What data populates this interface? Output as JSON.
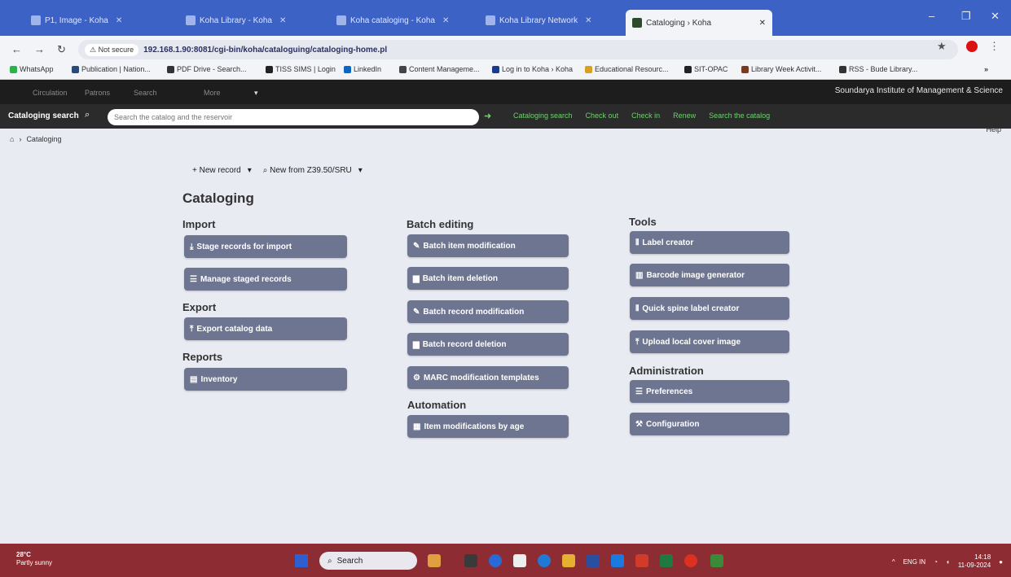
{
  "browser": {
    "tabs": [
      {
        "label": "P1, Image - Koha",
        "icon": "page-icon"
      },
      {
        "label": "Koha Library - Koha",
        "icon": "google-icon"
      },
      {
        "label": "Koha cataloging - Koha",
        "icon": "page-icon"
      },
      {
        "label": "Koha Library Network",
        "icon": "page-icon"
      },
      {
        "label": "Cataloging › Koha",
        "icon": "koha-icon",
        "active": true
      }
    ],
    "security_label": "Not secure",
    "url": "192.168.1.90:8081/cgi-bin/koha/cataloguing/cataloging-home.pl",
    "bookmarks": [
      "WhatsApp",
      "Publication | Nation...",
      "PDF Drive - Search...",
      "TISS SIMS | Login",
      "LinkedIn",
      "Content Manageme...",
      "Log in to Koha › Koha",
      "Educational Resourc...",
      "SIT-OPAC",
      "Library Week Activit...",
      "RSS - Bude Library..."
    ]
  },
  "koha": {
    "top_links": [
      "Circulation",
      "Patrons",
      "Search",
      "More"
    ],
    "library_name": "Soundarya Institute of Management & Science",
    "search": {
      "label": "Cataloging search",
      "placeholder": "Search the catalog and the reservoir",
      "tabs": [
        "Cataloging search",
        "Check out",
        "Check in",
        "Renew",
        "Search the catalog"
      ]
    },
    "breadcrumb": "Cataloging",
    "help": "Help",
    "toolbar": {
      "new_record": "+ New record",
      "new_z3950": "New from Z39.50/SRU"
    },
    "page_title": "Cataloging",
    "sections": {
      "import": {
        "title": "Import",
        "buttons": [
          "Stage records for import",
          "Manage staged records"
        ]
      },
      "export": {
        "title": "Export",
        "buttons": [
          "Export catalog data"
        ]
      },
      "reports": {
        "title": "Reports",
        "buttons": [
          "Inventory"
        ]
      },
      "batch": {
        "title": "Batch editing",
        "buttons": [
          "Batch item modification",
          "Batch item deletion",
          "Batch record modification",
          "Batch record deletion",
          "MARC modification templates"
        ]
      },
      "automation": {
        "title": "Automation",
        "buttons": [
          "Item modifications by age"
        ]
      },
      "tools": {
        "title": "Tools",
        "buttons": [
          "Label creator",
          "Barcode image generator",
          "Quick spine label creator",
          "Upload local cover image"
        ]
      },
      "admin": {
        "title": "Administration",
        "buttons": [
          "Preferences",
          "Configuration"
        ]
      }
    }
  },
  "taskbar": {
    "weather": "28°C",
    "weather_sub": "Partly sunny",
    "search_label": "Search",
    "lang": "ENG IN",
    "time": "14:18",
    "date": "11-09-2024"
  }
}
